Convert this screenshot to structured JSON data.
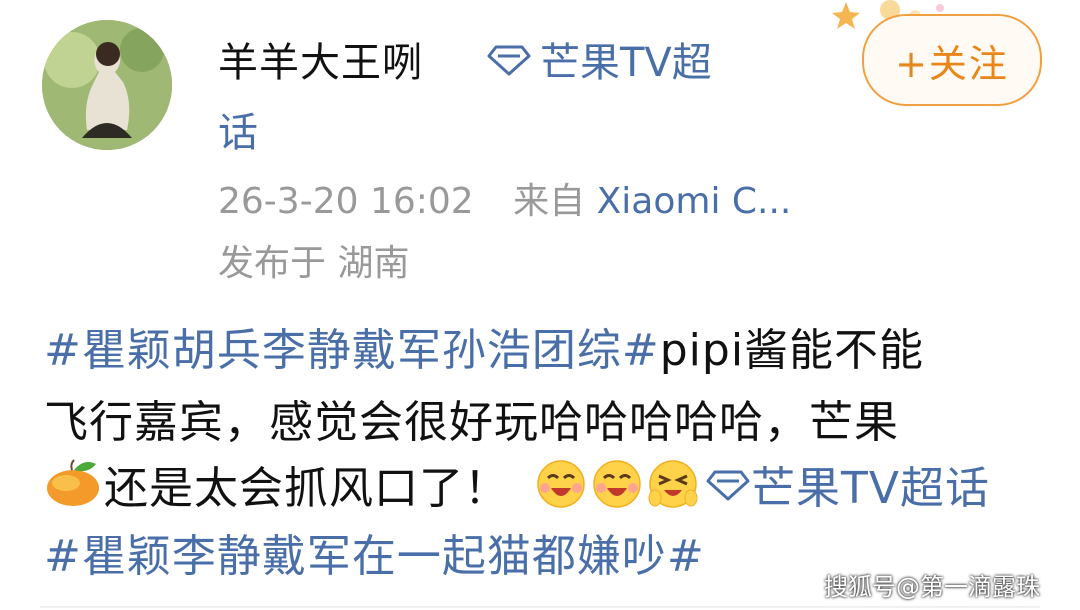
{
  "post_header": {
    "username": "羊羊大王咧",
    "supertopic_label_a": "芒果TV超",
    "supertopic_label_b": "话",
    "follow_label": "+关注",
    "time": "26-3-20 16:02",
    "from_label": "来自",
    "device": "Xiaomi C...",
    "location": "发布于 湖南"
  },
  "post_body": {
    "line1_tag": "#瞿颖胡兵李静戴军孙浩团综#",
    "line1_text": "pipi酱能不能",
    "line2_text": "飞行嘉宾，感觉会很好玩哈哈哈哈哈，芒果",
    "line3_text": "还是太会抓风口了！",
    "line3_supertopic": "芒果TV超话",
    "line4_tag": "#瞿颖李静戴军在一起猫都嫌吵#"
  },
  "icons": {
    "supertopic": "diamond-icon",
    "mango": "mango-emoji",
    "laugh": "laughing-emoji",
    "giggle": "giggle-emoji"
  },
  "colors": {
    "link_blue": "#4a6fa8",
    "follow_orange": "#e8861a",
    "meta_gray": "#999999"
  },
  "watermark": "搜狐号@第一滴露珠"
}
